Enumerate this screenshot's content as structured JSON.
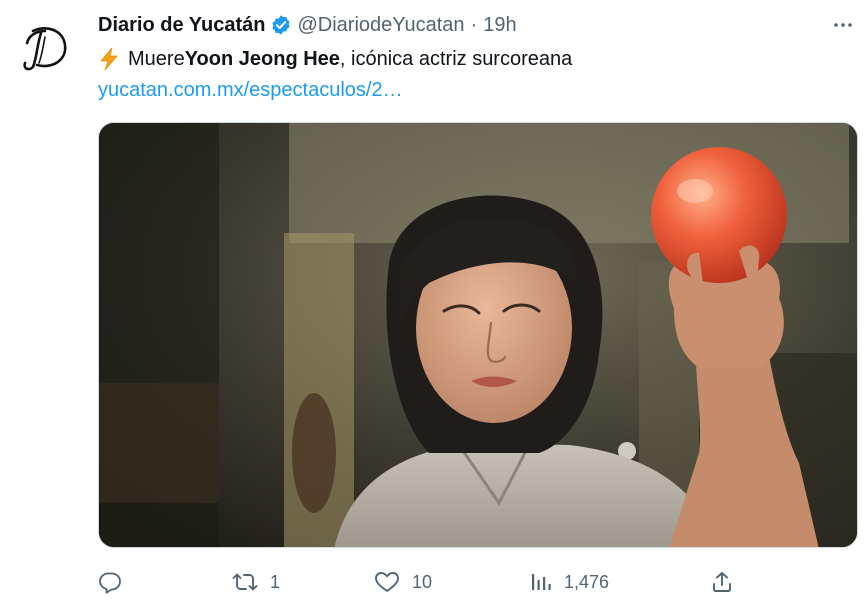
{
  "tweet": {
    "author": {
      "display_name": "Diario de Yucatán",
      "handle": "@DiariodeYucatan",
      "avatar_letter": "D",
      "verified_color": "#1d9bf0"
    },
    "separator": "·",
    "time": "19h",
    "text": {
      "bolt_icon": "high-voltage-emoji",
      "part1": "Muere ",
      "bold": "Yoon Jeong Hee",
      "part2": ", icónica actriz surcoreana"
    },
    "link": "yucatan.com.mx/espectaculos/2…",
    "media": {
      "description_icon": "photo"
    },
    "actions": {
      "reply": {
        "icon": "reply-icon",
        "count": ""
      },
      "retweet": {
        "icon": "retweet-icon",
        "count": "1"
      },
      "like": {
        "icon": "heart-icon",
        "count": "10"
      },
      "views": {
        "icon": "views-icon",
        "count": "1,476"
      },
      "share": {
        "icon": "share-icon",
        "count": ""
      }
    }
  },
  "colors": {
    "text_primary": "#0f1419",
    "text_secondary": "#536471",
    "link": "#1d9bf0"
  }
}
